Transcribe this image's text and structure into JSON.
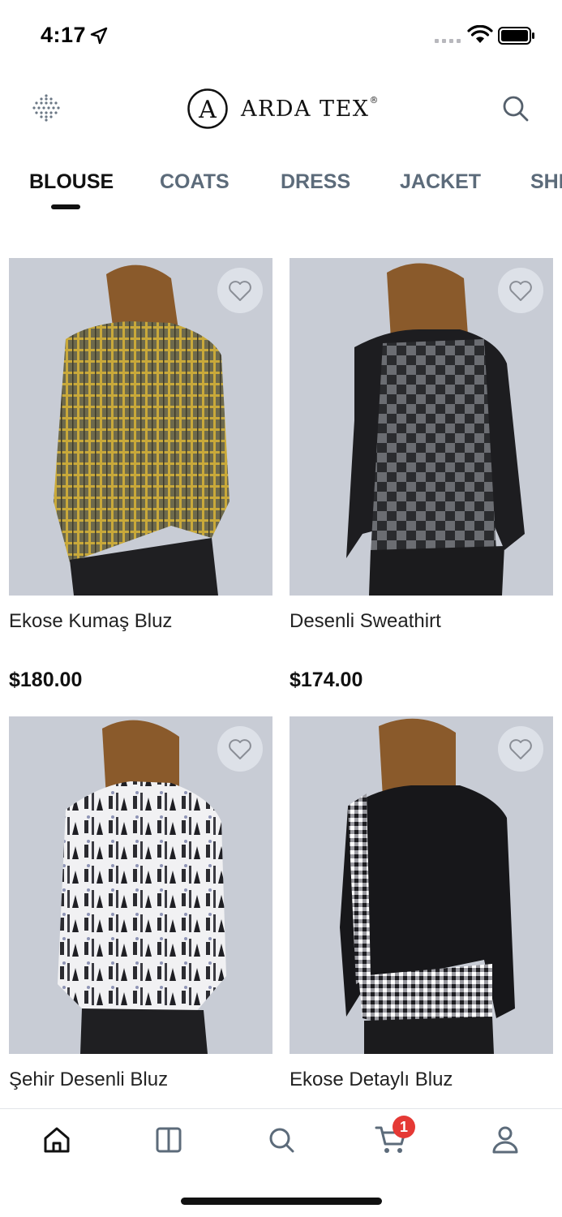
{
  "status_bar": {
    "time": "4:17"
  },
  "header": {
    "logo_letter": "A",
    "logo_text": "ARDA TEX",
    "logo_reg": "®"
  },
  "tabs": [
    {
      "label": "BLOUSE",
      "active": true
    },
    {
      "label": "COATS",
      "active": false
    },
    {
      "label": "DRESS",
      "active": false
    },
    {
      "label": "JACKET",
      "active": false
    },
    {
      "label": "SHI",
      "active": false
    }
  ],
  "products": [
    {
      "name": "Ekose Kumaş Bluz",
      "price": "$180.00",
      "icon": "plaid-blouse-image"
    },
    {
      "name": "Desenli Sweathirt",
      "price": "$174.00",
      "icon": "checked-sweatshirt-image"
    },
    {
      "name": "Şehir Desenli Bluz",
      "price": "",
      "icon": "city-print-blouse-image"
    },
    {
      "name": "Ekose Detaylı Bluz",
      "price": "",
      "icon": "checked-detail-blouse-image"
    }
  ],
  "bottom_nav": {
    "items": [
      "home-icon",
      "catalog-icon",
      "search-icon",
      "cart-icon",
      "user-icon"
    ],
    "cart_badge": "1"
  },
  "colors": {
    "accent_badge": "#e53935",
    "tab_inactive": "#5c6b7a",
    "tab_active": "#111111"
  }
}
